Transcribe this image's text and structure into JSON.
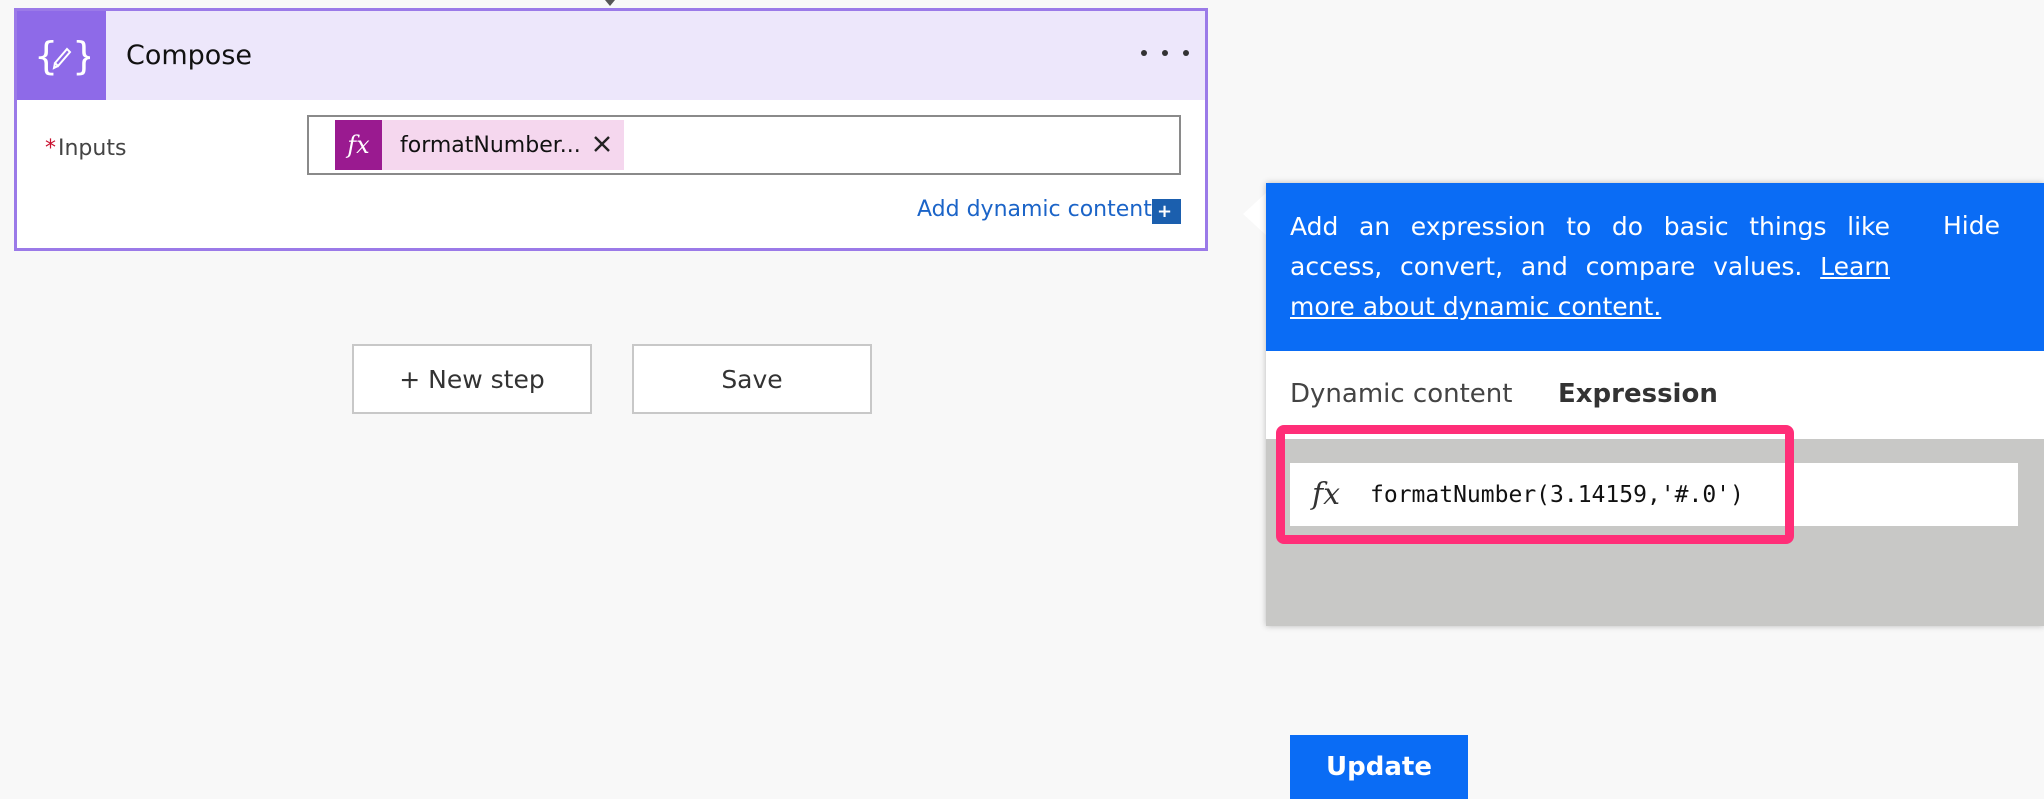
{
  "compose_card": {
    "title": "Compose",
    "icon": "curly-braces-pencil-icon",
    "more_icon": "more-dots-icon",
    "inputs_required_mark": "*",
    "inputs_label": "Inputs",
    "token": {
      "icon_label": "fx",
      "text": "formatNumber...",
      "close_icon": "close-icon"
    },
    "add_dynamic_label": "Add dynamic content",
    "add_dynamic_icon_label": "+"
  },
  "buttons": {
    "new_step": "+ New step",
    "save": "Save"
  },
  "expression_panel": {
    "banner_text": "Add an expression to do basic things like access, convert, and compare values.",
    "banner_link": "Learn more about dynamic content.",
    "hide_label": "Hide",
    "tabs": [
      {
        "label": "Dynamic content",
        "active": false
      },
      {
        "label": "Expression",
        "active": true
      }
    ],
    "expression_icon_label": "fx",
    "expression_value": "formatNumber(3.14159,'#.0')",
    "update_label": "Update"
  },
  "colors": {
    "card_border": "#9b7ae8",
    "card_header": "#ede7fb",
    "token_bg": "#f5d7ee",
    "token_icon": "#9a1a90",
    "panel_banner": "#0a6cf5",
    "highlight": "#ff2e78",
    "link": "#1b64c8"
  }
}
